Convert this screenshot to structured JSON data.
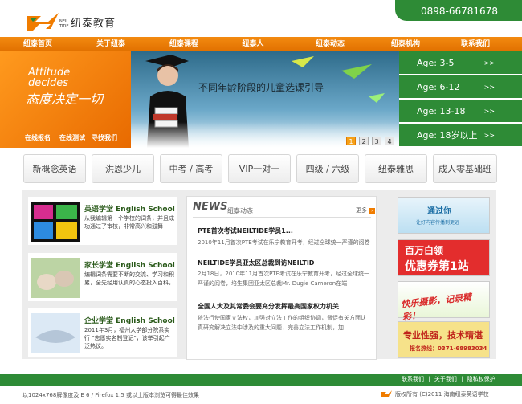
{
  "header": {
    "logo_text": "纽泰教育",
    "logo_mark_text": "NEIL TIDE",
    "phone": "0898-66781678"
  },
  "nav": {
    "items": [
      "纽泰首页",
      "关于纽泰",
      "纽泰课程",
      "纽泰人",
      "纽泰动态",
      "纽泰机构",
      "联系我们"
    ]
  },
  "banner": {
    "slogan_en": "Attitude\ndecides",
    "slogan_cn": "态度决定一切",
    "caption": "不同年龄阶段的儿童选课引导",
    "links": [
      "在线报名",
      "在线测试",
      "寻找我们"
    ],
    "pages": [
      "1",
      "2",
      "3",
      "4"
    ],
    "active_page": "1"
  },
  "ages": [
    {
      "label": "Age: 3-5",
      "arrow": ">>"
    },
    {
      "label": "Age: 6-12",
      "arrow": ">>"
    },
    {
      "label": "Age: 13-18",
      "arrow": ">>"
    },
    {
      "label": "Age: 18岁以上",
      "arrow": ">>"
    }
  ],
  "courses": [
    "新概念英语",
    "洪恩少儿",
    "中考 / 高考",
    "VIP一对一",
    "四级 / 六级",
    "纽泰雅思",
    "成人零基础班"
  ],
  "schools": [
    {
      "title": "英语学堂 English School",
      "desc": "从我编辑第一个学校的词条，并且成功通过了审核，非常高兴和鼓舞"
    },
    {
      "title": "家长学堂 English School",
      "desc": "编辑词条需要不断的交流、学习和积累，全先经用认真的心态投入百科，"
    },
    {
      "title": "企业学堂 English School",
      "desc": "2011年3月，福州大学部分院系实行 \"志愿实名制登记\"，该举引起广泛热议。"
    }
  ],
  "news": {
    "logo": "NEWS",
    "heading": "纽泰动态",
    "more_label": "更多",
    "items": [
      {
        "title": "PTE首次考试NEILTIDE学员1...",
        "body": "2010年11月首次PTE考试在乐宁教育开考，经过全球统一严谨的阅卷"
      },
      {
        "title": "NEILTIDE学员亚太区总裁到访NEILTID",
        "body": "2月18日，2010年11月首次PTE考试在乐宁教育开考，经过全球统一严谨的阅卷，培生集团亚太区总裁Mr. Dugie Cameron在端"
      },
      {
        "title": "全国人大及其常委会要充分发挥最高国家权力机关",
        "body": "依法行使国家立法权，加强对立法工作的组织协调，督促有关方面认真研究解决立法中涉及的重大问题，完善立法工作机制，加"
      }
    ]
  },
  "ads": [
    {
      "line1": "通过你",
      "line2": "让好内容传播到更远"
    },
    {
      "line1": "百万白领",
      "line2": "优惠券第1站"
    },
    {
      "line1": "快乐摄影，记录精彩！",
      "line2": ""
    },
    {
      "line1": "专业性强，技术精湛",
      "line2": "报名热线：0371-68983034"
    }
  ],
  "footer": {
    "links": [
      "联系我们",
      "关于我们",
      "隐私权保护"
    ],
    "left": "以1024x768解像度及IE 6 / Firefox 1.5 或以上版本浏览可得最佳效果",
    "copyright": "版权所有 (C)2011 海南纽泰英语学校"
  },
  "colors": {
    "green": "#2e8b36",
    "orange": "#f07c00"
  }
}
